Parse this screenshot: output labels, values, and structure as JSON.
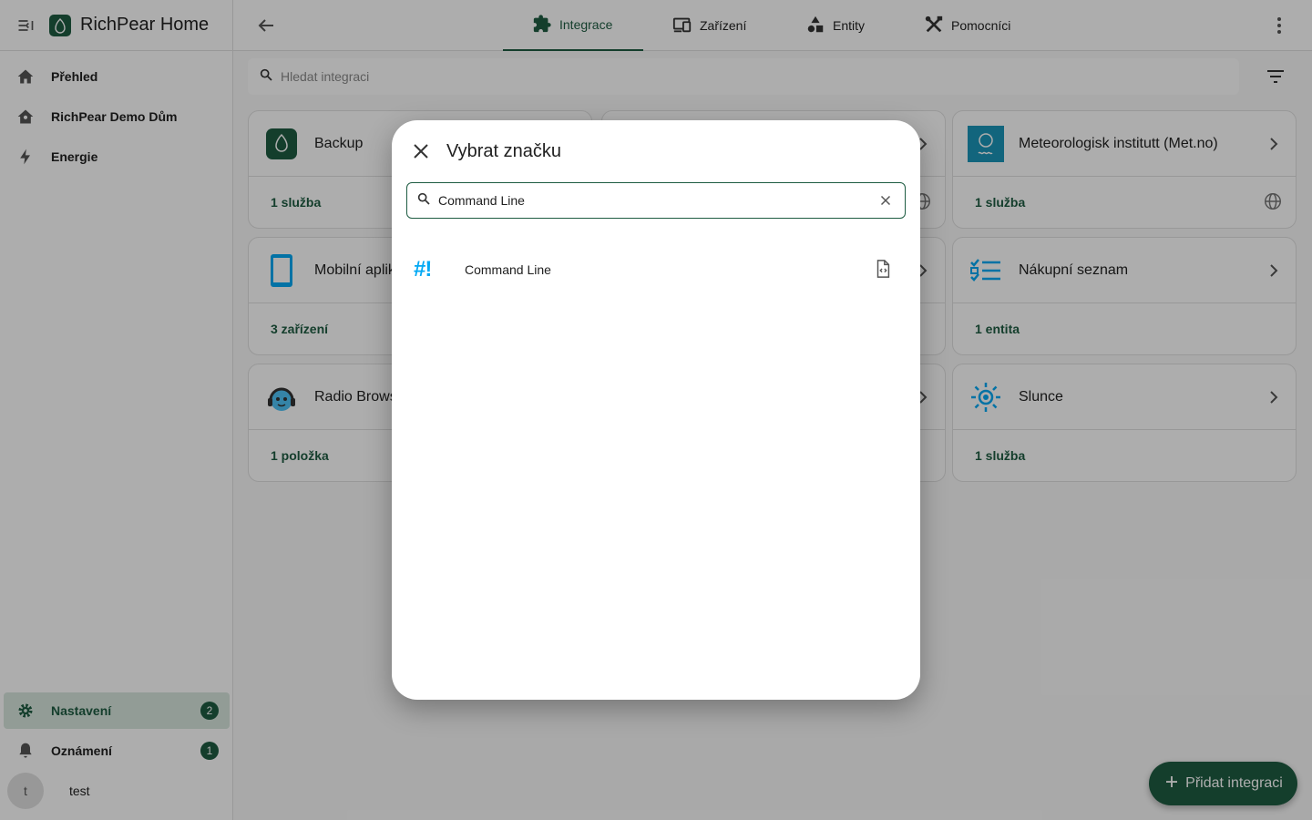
{
  "app": {
    "title": "RichPear Home"
  },
  "sidebar": {
    "items": [
      {
        "label": "Přehled",
        "icon": "home-icon"
      },
      {
        "label": "RichPear Demo Dům",
        "icon": "home-account-icon"
      },
      {
        "label": "Energie",
        "icon": "lightning-icon"
      }
    ],
    "bottom": [
      {
        "label": "Nastavení",
        "icon": "gear-icon",
        "badge": "2"
      },
      {
        "label": "Oznámení",
        "icon": "bell-icon",
        "badge": "1"
      }
    ],
    "user": {
      "initial": "t",
      "name": "test"
    }
  },
  "tabs": [
    {
      "label": "Integrace",
      "icon": "puzzle-icon",
      "active": true
    },
    {
      "label": "Zařízení",
      "icon": "devices-icon"
    },
    {
      "label": "Entity",
      "icon": "shapes-icon"
    },
    {
      "label": "Pomocníci",
      "icon": "tools-icon"
    }
  ],
  "search": {
    "placeholder": "Hledat integraci"
  },
  "cards": [
    {
      "name": "Backup",
      "footer": "1 služba"
    },
    {
      "name": "Meteorologisk institutt (Met.no)",
      "footer": "1 služba"
    },
    {
      "name": "Mobilní aplikace",
      "footer": "3 zařízení"
    },
    {
      "name": "Nákupní seznam",
      "footer": "1 entita"
    },
    {
      "name": "Radio Browser",
      "footer": "1 položka"
    },
    {
      "name": "Slunce",
      "footer": "1 služba"
    }
  ],
  "fab": {
    "label": "Přidat integraci"
  },
  "dialog": {
    "title": "Vybrat značku",
    "search_value": "Command Line",
    "result": {
      "logo_text": "#!",
      "name": "Command Line"
    }
  },
  "colors": {
    "primary": "#1e5c42",
    "active_bg": "#d7e6dd",
    "command_line_blue": "#03a9f4",
    "met_bg": "#1b96b8"
  }
}
